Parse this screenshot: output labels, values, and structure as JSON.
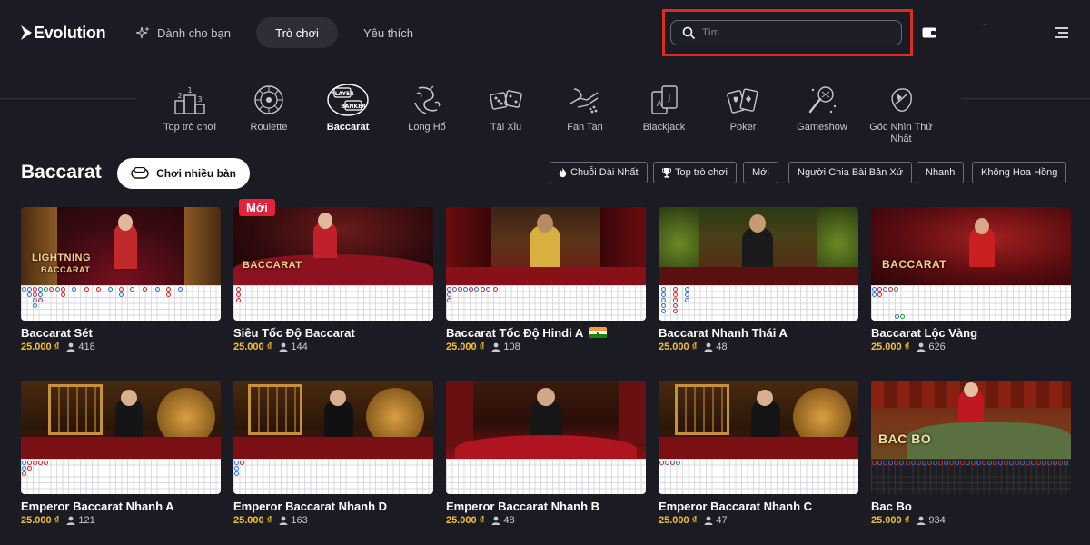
{
  "header": {
    "logo_text": "Evolution",
    "nav": [
      {
        "label": "Dành cho bạn"
      },
      {
        "label": "Trò chơi"
      },
      {
        "label": "Yêu thích"
      }
    ],
    "search_placeholder": "Tìm",
    "user_dash": "-"
  },
  "categories": [
    {
      "label": "Top trò chơi",
      "icon": "podium-icon"
    },
    {
      "label": "Roulette",
      "icon": "roulette-wheel-icon"
    },
    {
      "label": "Baccarat",
      "icon": "player-banker-icon",
      "active": true
    },
    {
      "label": "Long Hổ",
      "icon": "dragon-tiger-icon"
    },
    {
      "label": "Tài Xỉu",
      "icon": "dice-icon"
    },
    {
      "label": "Fan Tan",
      "icon": "hand-beads-icon"
    },
    {
      "label": "Blackjack",
      "icon": "cards-icon"
    },
    {
      "label": "Poker",
      "icon": "poker-cards-icon"
    },
    {
      "label": "Gameshow",
      "icon": "microphone-icon"
    },
    {
      "label": "Góc Nhìn Thứ Nhất",
      "icon": "first-person-icon"
    }
  ],
  "section": {
    "title": "Baccarat",
    "multi_table_label": "Chơi nhiều bàn",
    "filters": [
      {
        "label": "Chuỗi Dài Nhất",
        "icon": "fire-icon"
      },
      {
        "label": "Top trò chơi",
        "icon": "trophy-icon"
      },
      {
        "label": "Mới"
      },
      {
        "label": "Người Chia Bài Bản Xứ"
      },
      {
        "label": "Nhanh"
      },
      {
        "label": "Không Hoa Hồng"
      }
    ]
  },
  "badge_new": "Mới",
  "games": [
    {
      "name": "Baccarat Sét",
      "price": "25.000 ₫",
      "players": "418",
      "overlay": "LIGHTNING BACCARAT"
    },
    {
      "name": "Siêu Tốc Độ Baccarat",
      "price": "25.000 ₫",
      "players": "144",
      "overlay": "BACCARAT"
    },
    {
      "name": "Baccarat Tốc Độ Hindi A",
      "price": "25.000 ₫",
      "players": "108",
      "flag": "india-flag"
    },
    {
      "name": "Baccarat Nhanh Thái A",
      "price": "25.000 ₫",
      "players": "48"
    },
    {
      "name": "Baccarat Lộc Vàng",
      "price": "25.000 ₫",
      "players": "626",
      "overlay": "BACCARAT"
    },
    {
      "name": "Emperor Baccarat Nhanh A",
      "price": "25.000 ₫",
      "players": "121"
    },
    {
      "name": "Emperor Baccarat Nhanh D",
      "price": "25.000 ₫",
      "players": "163"
    },
    {
      "name": "Emperor Baccarat Nhanh B",
      "price": "25.000 ₫",
      "players": "48"
    },
    {
      "name": "Emperor Baccarat Nhanh C",
      "price": "25.000 ₫",
      "players": "47"
    },
    {
      "name": "Bac Bo",
      "price": "25.000 ₫",
      "players": "934",
      "overlay": "BAC BO"
    }
  ],
  "colors": {
    "background": "#1b1b24",
    "accent_price": "#f2c230",
    "search_highlight": "#e02a1f",
    "new_badge": "#e4223b"
  }
}
